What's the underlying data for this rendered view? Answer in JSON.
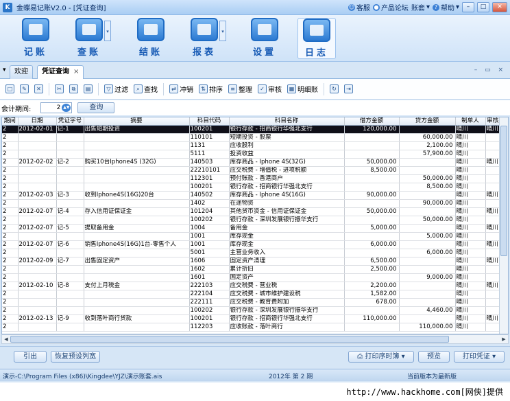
{
  "window": {
    "title": "金蝶易记账V2.0 - [凭证查询]"
  },
  "topright": {
    "service": "客服",
    "forum": "产品论坛",
    "account": "账套",
    "help": "帮助"
  },
  "modules": [
    {
      "label": "记账",
      "icon": "ledger-icon"
    },
    {
      "label": "查账",
      "icon": "search-ledger-icon"
    },
    {
      "label": "结账",
      "icon": "calendar-icon"
    },
    {
      "label": "报表",
      "icon": "chart-icon"
    },
    {
      "label": "设置",
      "icon": "gear-icon"
    },
    {
      "label": "日志",
      "icon": "log-icon"
    }
  ],
  "tabs": [
    {
      "label": "欢迎"
    },
    {
      "label": "凭证查询"
    }
  ],
  "toolbar": {
    "filter": "过滤",
    "find": "查找",
    "reverse": "冲销",
    "sort": "排序",
    "arrange": "整理",
    "audit": "审核",
    "detail": "明细账"
  },
  "filter": {
    "period_label": "会计期间:",
    "period_value": "2",
    "query_button": "查询"
  },
  "table": {
    "headers": [
      "期间",
      "日期",
      "凭证字号",
      "摘要",
      "科目代码",
      "科目名称",
      "借方金额",
      "贷方金额",
      "制单人",
      "审核人"
    ],
    "rows": [
      [
        "2",
        "2012-02-01",
        "记-1",
        "出售短期投资",
        "100201",
        "银行存款 - 招商银行华强北支行",
        "120,000.00",
        "",
        "晴川",
        "晴川"
      ],
      [
        "2",
        "",
        "",
        "",
        "110101",
        "短期投资 - 股票",
        "",
        "60,000.00",
        "晴川",
        ""
      ],
      [
        "2",
        "",
        "",
        "",
        "1131",
        "应收股利",
        "",
        "2,100.00",
        "晴川",
        ""
      ],
      [
        "2",
        "",
        "",
        "",
        "5111",
        "投资收益",
        "",
        "57,900.00",
        "晴川",
        ""
      ],
      [
        "2",
        "2012-02-02",
        "记-2",
        "购买10台Iphone4S (32G)",
        "140503",
        "库存商品 - Iphone 4S(32G)",
        "50,000.00",
        "",
        "晴川",
        "晴川"
      ],
      [
        "2",
        "",
        "",
        "",
        "22210101",
        "应交税费 - 增值税 - 进项税额",
        "8,500.00",
        "",
        "晴川",
        ""
      ],
      [
        "2",
        "",
        "",
        "",
        "112301",
        "预付账款 - 香港商户",
        "",
        "50,000.00",
        "晴川",
        ""
      ],
      [
        "2",
        "",
        "",
        "",
        "100201",
        "银行存款 - 招商银行华强北支行",
        "",
        "8,500.00",
        "晴川",
        ""
      ],
      [
        "2",
        "2012-02-03",
        "记-3",
        "收到Iphone4S(16G)20台",
        "140502",
        "库存商品 - Iphone 4S(16G)",
        "90,000.00",
        "",
        "晴川",
        "晴川"
      ],
      [
        "2",
        "",
        "",
        "",
        "1402",
        "在途物资",
        "",
        "90,000.00",
        "晴川",
        ""
      ],
      [
        "2",
        "2012-02-07",
        "记-4",
        "存入信用证保证金",
        "101204",
        "其他货币资金 - 信用证保证金",
        "50,000.00",
        "",
        "晴川",
        "晴川"
      ],
      [
        "2",
        "",
        "",
        "",
        "100202",
        "银行存款 - 深圳发展银行振华支行",
        "",
        "50,000.00",
        "晴川",
        ""
      ],
      [
        "2",
        "2012-02-07",
        "记-5",
        "提取备用金",
        "1004",
        "备用金",
        "5,000.00",
        "",
        "晴川",
        "晴川"
      ],
      [
        "2",
        "",
        "",
        "",
        "1001",
        "库存现金",
        "",
        "5,000.00",
        "晴川",
        ""
      ],
      [
        "2",
        "2012-02-07",
        "记-6",
        "销售Iphone4S(16G)1台-零售个人",
        "1001",
        "库存现金",
        "6,000.00",
        "",
        "晴川",
        "晴川"
      ],
      [
        "2",
        "",
        "",
        "",
        "5001",
        "主营业务收入",
        "",
        "6,000.00",
        "晴川",
        ""
      ],
      [
        "2",
        "2012-02-09",
        "记-7",
        "出售固定资产",
        "1606",
        "固定资产清理",
        "6,500.00",
        "",
        "晴川",
        "晴川"
      ],
      [
        "2",
        "",
        "",
        "",
        "1602",
        "累计折旧",
        "2,500.00",
        "",
        "晴川",
        ""
      ],
      [
        "2",
        "",
        "",
        "",
        "1601",
        "固定资产",
        "",
        "9,000.00",
        "晴川",
        ""
      ],
      [
        "2",
        "2012-02-10",
        "记-8",
        "支付上月税金",
        "222103",
        "应交税费 - 营业税",
        "2,200.00",
        "",
        "晴川",
        "晴川"
      ],
      [
        "2",
        "",
        "",
        "",
        "222104",
        "应交税费 - 城市维护建设税",
        "1,582.00",
        "",
        "晴川",
        ""
      ],
      [
        "2",
        "",
        "",
        "",
        "222111",
        "应交税费 - 教育费附加",
        "678.00",
        "",
        "晴川",
        ""
      ],
      [
        "2",
        "",
        "",
        "",
        "100202",
        "银行存款 - 深圳发展银行振华支行",
        "",
        "4,460.00",
        "晴川",
        ""
      ],
      [
        "2",
        "2012-02-13",
        "记-9",
        "收到落叶商行货款",
        "100201",
        "银行存款 - 招商银行华强北支行",
        "110,000.00",
        "",
        "晴川",
        "晴川"
      ],
      [
        "2",
        "",
        "",
        "",
        "112203",
        "应收账款 - 落叶商行",
        "",
        "110,000.00",
        "晴川",
        ""
      ]
    ]
  },
  "bottom": {
    "export": "引出",
    "restore": "恢复预设列宽",
    "print_order": "打印序时簿",
    "preview": "预览",
    "print_voucher": "打印凭证"
  },
  "status": {
    "path": "演示-C:\\Program Files (x86)\\Kingdee\\YJZ\\演示账套.ais",
    "period": "2012年 第 2 期",
    "version": "当前版本为最新版"
  },
  "watermark": "http://www.hackhome.com[网侠]提供"
}
